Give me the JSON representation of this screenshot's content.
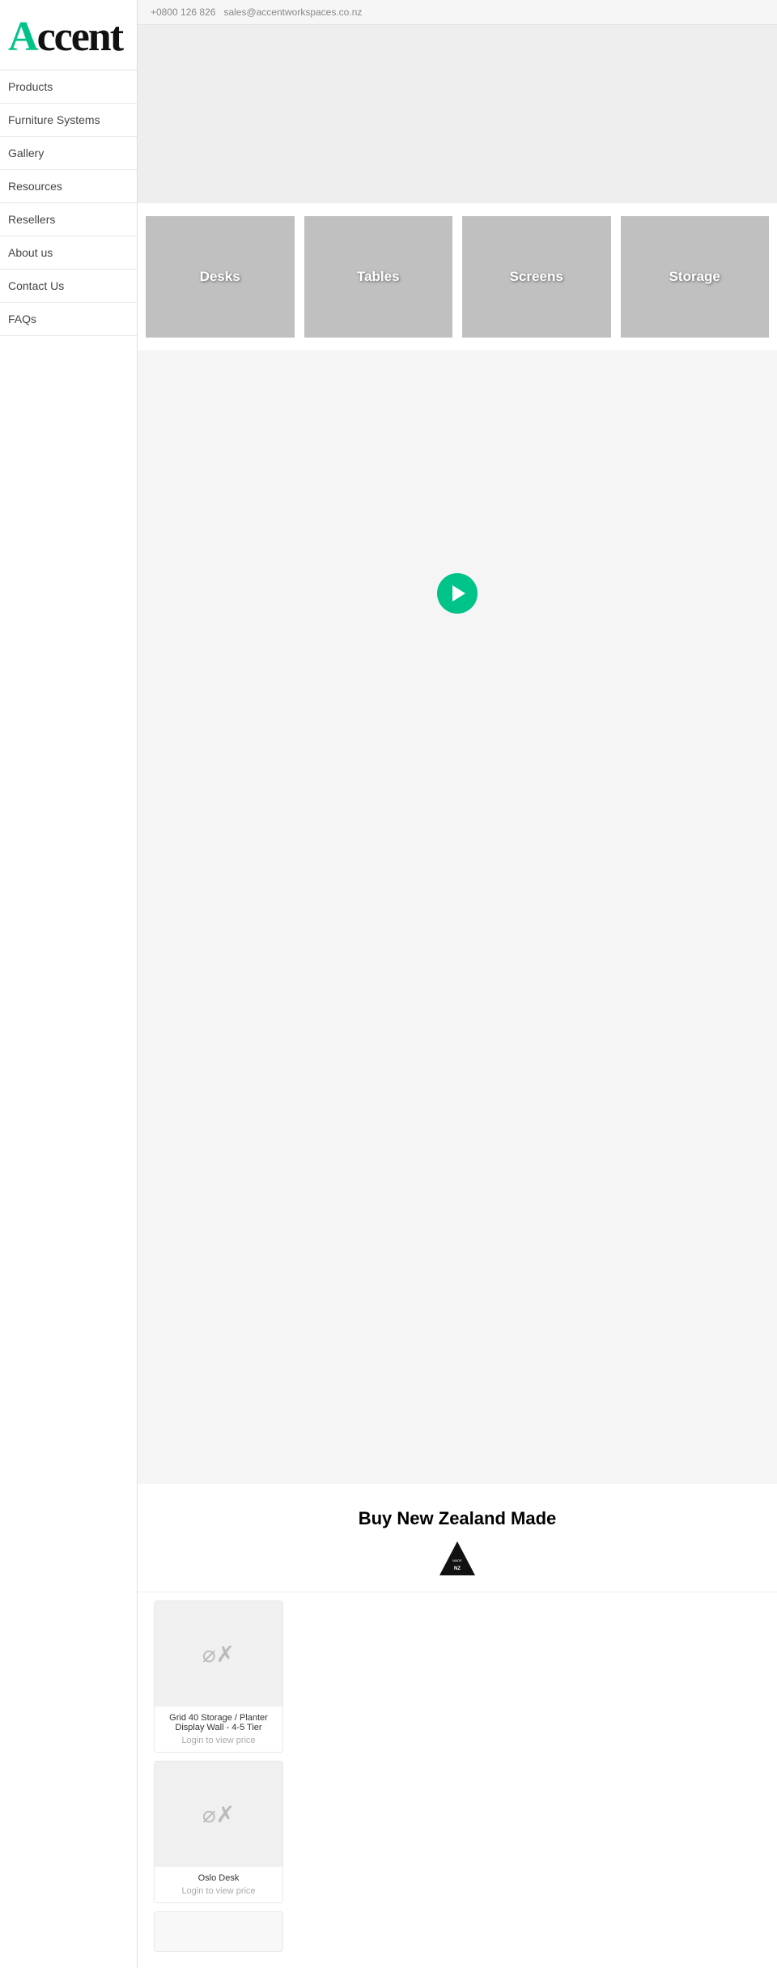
{
  "topbar": {
    "phone": "+0800 126 826",
    "email": "sales@accentworkspaces.co.nz"
  },
  "sidebar": {
    "logo": {
      "text_a": "A",
      "text_rest": "ccent"
    },
    "nav_items": [
      {
        "label": "Products",
        "id": "products"
      },
      {
        "label": "Furniture Systems",
        "id": "furniture-systems"
      },
      {
        "label": "Gallery",
        "id": "gallery"
      },
      {
        "label": "Resources",
        "id": "resources"
      },
      {
        "label": "Resellers",
        "id": "resellers"
      },
      {
        "label": "About us",
        "id": "about-us"
      },
      {
        "label": "Contact Us",
        "id": "contact-us"
      },
      {
        "label": "FAQs",
        "id": "faqs"
      }
    ]
  },
  "categories": [
    {
      "label": "Desks",
      "id": "desks"
    },
    {
      "label": "Tables",
      "id": "tables"
    },
    {
      "label": "Screens",
      "id": "screens"
    },
    {
      "label": "Storage",
      "id": "storage"
    }
  ],
  "nz_made": {
    "title": "Buy New Zealand Made"
  },
  "products": [
    {
      "name": "Grid 40 Storage / Planter Display Wall - 4-5 Tier",
      "price": "Login to view price",
      "id": "grid-40-storage"
    },
    {
      "name": "Oslo Desk",
      "price": "Login to view price",
      "id": "oslo-desk"
    }
  ]
}
